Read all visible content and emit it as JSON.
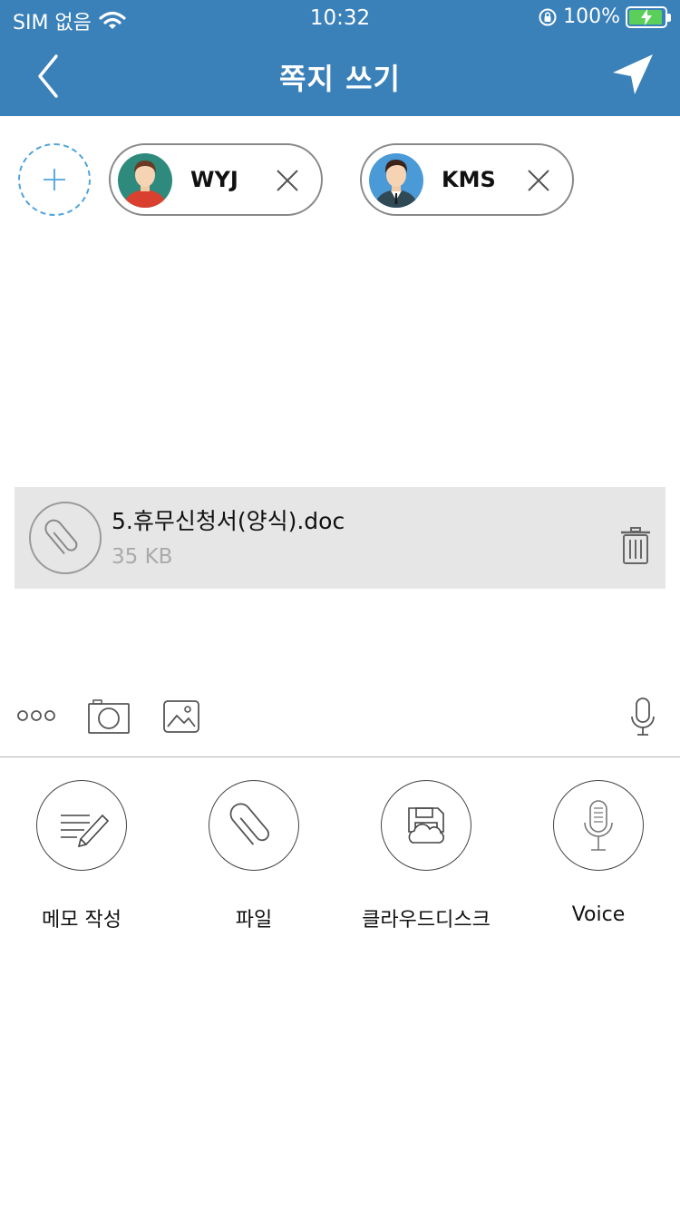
{
  "status_bar": {
    "carrier": "SIM 없음",
    "time": "10:32",
    "battery_percent": "100%",
    "battery_level": 1.0,
    "wifi_icon": "wifi-icon",
    "rotation_lock_icon": "rotation-lock-icon"
  },
  "header": {
    "title": "쪽지 쓰기",
    "back_icon": "chevron-left-icon",
    "send_icon": "paper-plane-icon",
    "background_color": "#3a80b9"
  },
  "recipients": {
    "add_icon": "plus-icon",
    "items": [
      {
        "name": "WYJ"
      },
      {
        "name": "KMS"
      }
    ]
  },
  "attachment": {
    "file_name": "5.휴무신청서(양식).doc",
    "file_size": "35 KB",
    "icon": "paperclip-icon",
    "delete_icon": "trash-icon"
  },
  "toolbar": {
    "more_icon": "more-dots-icon",
    "camera_icon": "camera-icon",
    "image_icon": "image-icon",
    "mic_icon": "microphone-icon"
  },
  "actions": [
    {
      "label": "메모 작성",
      "icon": "memo-pencil-icon"
    },
    {
      "label": "파일",
      "icon": "paperclip-icon"
    },
    {
      "label": "클라우드디스크",
      "icon": "cloud-disk-icon"
    },
    {
      "label": "Voice",
      "icon": "microphone-icon"
    }
  ],
  "colors": {
    "accent": "#3a80b9",
    "dashed_add": "#4fa3dd",
    "attachment_bg": "#e6e6e6",
    "battery_fill": "#5ad05a"
  }
}
